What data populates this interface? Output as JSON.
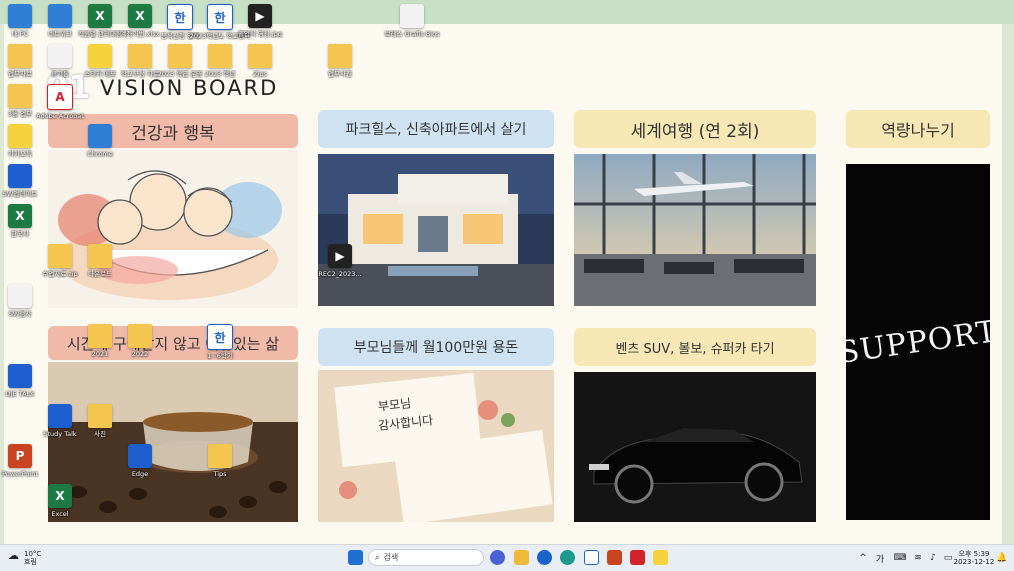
{
  "board": {
    "number": "01",
    "title": "VISION BOARD",
    "labels": {
      "health": "건강과 행복",
      "house": "파크힐스, 신축아파트에서 살기",
      "travel": "세계여행 (연 2회)",
      "share": "역량나누기",
      "time": "시간에 구애받지 않고 여유있는 삶",
      "parents": "부모님들께 월100만원 용돈",
      "car": "벤츠 SUV, 볼보, 슈퍼카 타기"
    },
    "support_text": "SUPPORT",
    "card_text": [
      "부모님",
      "감사합니다"
    ],
    "colors": {
      "label_blue": "#cfe2f1",
      "label_gold": "#f7e7b5",
      "label_pink": "#f0b9a8"
    }
  },
  "desktop_icons": [
    {
      "label": "내 PC",
      "icon": "pc-icon",
      "type": "pc"
    },
    {
      "label": "네트워크",
      "icon": "network-icon",
      "type": "pc"
    },
    {
      "label": "직원별 관리대장",
      "icon": "excel-icon",
      "type": "excel"
    },
    {
      "label": "계좌기번.xlsx",
      "icon": "excel-icon",
      "type": "excel"
    },
    {
      "label": "등록신청 양식",
      "icon": "hwp-icon",
      "type": "hwp"
    },
    {
      "label": "2023학년도 학교평가",
      "icon": "hwp-icon",
      "type": "hwp"
    },
    {
      "label": "졸업식 영상.jpg",
      "icon": "image-icon",
      "type": "dark"
    },
    {
      "label": "브레스 Grafis Bios",
      "icon": "video-icon",
      "type": "white"
    },
    {
      "label": "업무자료",
      "icon": "folder-icon",
      "type": "folder"
    },
    {
      "label": "휴지통",
      "icon": "recycle-bin-icon",
      "type": "white"
    },
    {
      "label": "스티커 메모",
      "icon": "sticky-notes-icon",
      "type": "yellow"
    },
    {
      "label": "학교구성 자료",
      "icon": "folder-icon",
      "type": "folder"
    },
    {
      "label": "2023 학급 운영",
      "icon": "folder-icon",
      "type": "folder"
    },
    {
      "label": "2023 학년",
      "icon": "folder-icon",
      "type": "folder"
    },
    {
      "label": "Zips",
      "icon": "folder-icon",
      "type": "folder"
    },
    {
      "label": "업무사진",
      "icon": "folder-icon",
      "type": "folder"
    },
    {
      "label": "3월 업무",
      "icon": "folder-icon",
      "type": "folder"
    },
    {
      "label": "Adobe Acrobat",
      "icon": "pdf-icon",
      "type": "pdf"
    },
    {
      "label": "카카오톡",
      "icon": "kakaotalk-icon",
      "type": "yellow"
    },
    {
      "label": "Chrome",
      "icon": "chrome-icon",
      "type": "pc"
    },
    {
      "label": "SW업데이트",
      "icon": "shield-icon",
      "type": "blue"
    },
    {
      "label": "한국사",
      "icon": "excel-icon",
      "type": "excel"
    },
    {
      "label": "수업자료.zip",
      "icon": "zip-icon",
      "type": "folder"
    },
    {
      "label": "다운로드",
      "icon": "folder-icon",
      "type": "folder"
    },
    {
      "label": "SW검사",
      "icon": "scan-icon",
      "type": "white"
    },
    {
      "label": "Excel",
      "icon": "excel-icon",
      "type": "excel"
    },
    {
      "label": "PowerPoint",
      "icon": "powerpoint-icon",
      "type": "ppt"
    },
    {
      "label": "Edge",
      "icon": "edge-icon",
      "type": "blue"
    },
    {
      "label": "사진",
      "icon": "folder-icon",
      "type": "folder"
    },
    {
      "label": "2021",
      "icon": "folder-icon",
      "type": "folder"
    },
    {
      "label": "2022",
      "icon": "folder-icon",
      "type": "folder"
    },
    {
      "label": "DJE TALK",
      "icon": "dje-talk-icon",
      "type": "blue"
    },
    {
      "label": "Study Talk",
      "icon": "study-icon",
      "type": "blue"
    },
    {
      "label": "REC2_2023...",
      "icon": "video-icon",
      "type": "dark"
    },
    {
      "label": "1~6학기",
      "icon": "hwp-icon",
      "type": "hwp"
    },
    {
      "label": "Tips",
      "icon": "folder-icon",
      "type": "folder"
    }
  ],
  "taskbar": {
    "weather_temp": "10°C",
    "weather_desc": "흐림",
    "search_placeholder": "검색",
    "ime": "가",
    "time": "오후 5:39",
    "date": "2023-12-12",
    "tray_icons": [
      "chevron-up-icon",
      "wifi-icon",
      "volume-icon",
      "battery-icon",
      "notification-icon"
    ],
    "pinned": [
      "start-icon",
      "search-icon",
      "chat-icon",
      "file-explorer-icon",
      "edge-icon",
      "store-icon",
      "hwp-icon",
      "powerpoint-icon",
      "kakaotalk-icon"
    ]
  }
}
